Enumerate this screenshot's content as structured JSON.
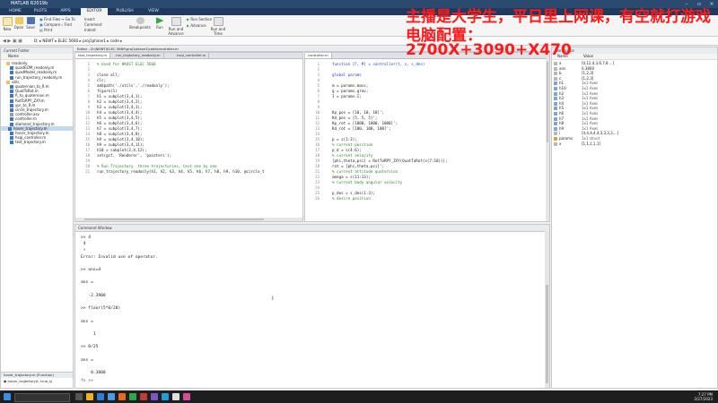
{
  "window": {
    "title": "MATLAB R2019b"
  },
  "tabs": [
    "HOME",
    "PLOTS",
    "APPS",
    "EDITOR",
    "PUBLISH",
    "VIEW"
  ],
  "ribbon": {
    "file": [
      "New",
      "Open",
      "Save"
    ],
    "navigate": [
      "Find Files",
      "Compare",
      "Print",
      "Go To",
      "Find"
    ],
    "edit": [
      "Insert",
      "Comment",
      "Indent"
    ],
    "breakpoints": "Breakpoints",
    "run": [
      "Run",
      "Run and Advance",
      "Run Section",
      "Advance",
      "Run and Time"
    ]
  },
  "address": {
    "path": "D: ▸ NEWT ▸ ELEC 5660 ▸ proj1phase1 ▸ code ▸"
  },
  "current_folder": {
    "title": "Current Folder",
    "column": "Name",
    "items": [
      {
        "name": "readonly",
        "type": "folder"
      },
      {
        "name": "quadEOM_readonly.m",
        "type": "m"
      },
      {
        "name": "quadModel_readonly.m",
        "type": "m"
      },
      {
        "name": "run_trajectory_readonly.m",
        "type": "m"
      },
      {
        "name": "utils",
        "type": "folder"
      },
      {
        "name": "quaternion_to_R.m",
        "type": "m"
      },
      {
        "name": "QuatToRot.m",
        "type": "m"
      },
      {
        "name": "R_to_quaternion.m",
        "type": "m"
      },
      {
        "name": "RotToRPY_ZXY.m",
        "type": "m"
      },
      {
        "name": "ypr_to_R.m",
        "type": "m"
      },
      {
        "name": "circle_trajectory.m",
        "type": "m"
      },
      {
        "name": "controller.asv",
        "type": "asv"
      },
      {
        "name": "controller.m",
        "type": "m"
      },
      {
        "name": "diamond_trajectory.m",
        "type": "m"
      },
      {
        "name": "hover_trajectory.m",
        "type": "m"
      },
      {
        "name": "hover_trajectory.m",
        "type": "m"
      },
      {
        "name": "hsqi_controller.m",
        "type": "m"
      },
      {
        "name": "test_trajectory.m",
        "type": "m"
      }
    ],
    "details_label": "hover_trajectory.m  (Function)",
    "details_item": "hover_trajectory(t, true_s)"
  },
  "editor_left": {
    "title": "Editor - D:\\NEWT\\ELEC 5660\\proj1phase1\\code\\controller.m",
    "tabs": [
      "test_trajectory.m",
      "run_trajectory_readonly.m",
      "hsqi_controller.m"
    ],
    "lines": [
      {
        "n": "1",
        "t": "% Used for HKUST ELEC 5660",
        "c": "cmt"
      },
      {
        "n": "2",
        "t": "",
        "c": ""
      },
      {
        "n": "3",
        "t": "close all;",
        "c": ""
      },
      {
        "n": "4",
        "t": "clc;",
        "c": ""
      },
      {
        "n": "5",
        "t": "addpath('./utils','./readonly');",
        "c": ""
      },
      {
        "n": "6",
        "t": "figure(1)",
        "c": ""
      },
      {
        "n": "7",
        "t": "h1 = subplot(3,4,1);",
        "c": ""
      },
      {
        "n": "8",
        "t": "h2 = subplot(3,4,2);",
        "c": ""
      },
      {
        "n": "9",
        "t": "h3 = subplot(3,4,3);",
        "c": ""
      },
      {
        "n": "10",
        "t": "h4 = subplot(3,4,4);",
        "c": ""
      },
      {
        "n": "11",
        "t": "h5 = subplot(3,4,5);",
        "c": ""
      },
      {
        "n": "12",
        "t": "h6 = subplot(3,4,6);",
        "c": ""
      },
      {
        "n": "13",
        "t": "h7 = subplot(3,4,7);",
        "c": ""
      },
      {
        "n": "14",
        "t": "h8 = subplot(3,4,8);",
        "c": ""
      },
      {
        "n": "15",
        "t": "h9 = subplot(3,4,10);",
        "c": ""
      },
      {
        "n": "16",
        "t": "h9 = subplot(3,4,11);",
        "c": ""
      },
      {
        "n": "17",
        "t": "h10 = subplot(3,4,12);",
        "c": ""
      },
      {
        "n": "18",
        "t": "set(gcf, 'Renderer', 'painters');",
        "c": ""
      },
      {
        "n": "19",
        "t": "",
        "c": ""
      },
      {
        "n": "20",
        "t": "% Run Trajectory  three trajectories, test one by one",
        "c": "cmt"
      },
      {
        "n": "21",
        "t": "run_trajectory_readonly(h1, h2, h3, h4, h5, h6, h7, h8, h9, h10, @circle_t",
        "c": ""
      }
    ]
  },
  "editor_right": {
    "tab": "controller.m",
    "lines": [
      {
        "n": "1",
        "t": "function [F, M] = controller(t, s, s_des)",
        "c": "kw"
      },
      {
        "n": "2",
        "t": "",
        "c": ""
      },
      {
        "n": "3",
        "t": "global params",
        "c": "kw"
      },
      {
        "n": "4",
        "t": "",
        "c": ""
      },
      {
        "n": "5",
        "t": "m = params.mass;",
        "c": ""
      },
      {
        "n": "6",
        "t": "g = params.grav;",
        "c": ""
      },
      {
        "n": "7",
        "t": "I = params.I;",
        "c": ""
      },
      {
        "n": "8",
        "t": "",
        "c": ""
      },
      {
        "n": "9",
        "t": "",
        "c": ""
      },
      {
        "n": "10",
        "t": "Kp_pos = [10, 10, 10]';",
        "c": ""
      },
      {
        "n": "11",
        "t": "Kd_pos = [5, 5, 5]';",
        "c": ""
      },
      {
        "n": "12",
        "t": "Kp_rot = [1000, 1000, 1000]';",
        "c": ""
      },
      {
        "n": "13",
        "t": "Kd_rot = [100, 100, 100]';",
        "c": ""
      },
      {
        "n": "14",
        "t": "",
        "c": ""
      },
      {
        "n": "15",
        "t": "p = s(1:3);",
        "c": ""
      },
      {
        "n": "16",
        "t": "% current position",
        "c": "cmt"
      },
      {
        "n": "17",
        "t": "p_d = s(4:6);",
        "c": ""
      },
      {
        "n": "18",
        "t": "% current velocity",
        "c": "cmt"
      },
      {
        "n": "19",
        "t": "[phi,theta,psi] = RotToRPY_ZXY(QuatToRot(s(7:10)));",
        "c": ""
      },
      {
        "n": "20",
        "t": "rot = [phi,theta,psi]';",
        "c": ""
      },
      {
        "n": "21",
        "t": "% current attitude quaternion",
        "c": "cmt"
      },
      {
        "n": "22",
        "t": "omega = s(11:13);",
        "c": ""
      },
      {
        "n": "23",
        "t": "% current body angular velocity",
        "c": "cmt"
      },
      {
        "n": "24",
        "t": "",
        "c": ""
      },
      {
        "n": "25",
        "t": "p_des = s_des(1:3);",
        "c": ""
      },
      {
        "n": "26",
        "t": "% desire position",
        "c": "cmt"
      }
    ]
  },
  "command_window": {
    "title": "Command Window",
    "lines": [
      {
        "t": ">> 4",
        "c": ""
      },
      {
        "t": " 4",
        "c": ""
      },
      {
        "t": " ↑",
        "c": "err"
      },
      {
        "t": "Error: Invalid use of operator.",
        "c": "err"
      },
      {
        "t": "",
        "c": ""
      },
      {
        "t": ">> ans=4",
        "c": ""
      },
      {
        "t": "",
        "c": ""
      },
      {
        "t": "ans =",
        "c": ""
      },
      {
        "t": "",
        "c": ""
      },
      {
        "t": "   -2.3900",
        "c": ""
      },
      {
        "t": "",
        "c": ""
      },
      {
        "t": ">> floor(5*0/20)",
        "c": ""
      },
      {
        "t": "",
        "c": ""
      },
      {
        "t": "ans =",
        "c": ""
      },
      {
        "t": "",
        "c": ""
      },
      {
        "t": "     1",
        "c": ""
      },
      {
        "t": "",
        "c": ""
      },
      {
        "t": ">> 0/25",
        "c": ""
      },
      {
        "t": "",
        "c": ""
      },
      {
        "t": "ans =",
        "c": ""
      },
      {
        "t": "",
        "c": ""
      },
      {
        "t": "    0.3800",
        "c": ""
      }
    ],
    "prompt": "fx >>"
  },
  "workspace": {
    "title": "Workspace",
    "columns": [
      "Name",
      "Value"
    ],
    "rows": [
      {
        "name": "a",
        "value": "[0,12,4,3,6,7,8 ...]"
      },
      {
        "name": "ans",
        "value": "0.3800"
      },
      {
        "name": "b",
        "value": "[1,2,3]"
      },
      {
        "name": "c",
        "value": "[1,2,3]"
      },
      {
        "name": "h1",
        "value": "1x1 Axes"
      },
      {
        "name": "h10",
        "value": "1x1 Axes"
      },
      {
        "name": "h2",
        "value": "1x1 Axes"
      },
      {
        "name": "h3",
        "value": "1x1 Axes"
      },
      {
        "name": "h4",
        "value": "1x1 Axes"
      },
      {
        "name": "h5",
        "value": "1x1 Axes"
      },
      {
        "name": "h6",
        "value": "1x1 Axes"
      },
      {
        "name": "h7",
        "value": "1x1 Axes"
      },
      {
        "name": "h8",
        "value": "1x1 Axes"
      },
      {
        "name": "h9",
        "value": "1x1 Axes"
      },
      {
        "name": "i",
        "value": "[4,4,4,4,4,3,3,3,3,...]"
      },
      {
        "name": "params",
        "value": "1x1 struct"
      },
      {
        "name": "x",
        "value": "[1,1,1,1,1]"
      }
    ]
  },
  "overlay": {
    "line1": "主播是大学生，平日里上网课，有空就打游戏",
    "line2": "电脑配置：",
    "line3": "2700X+3090+X470"
  },
  "taskbar": {
    "time": "7:27 PM",
    "date": "2/27/2023"
  },
  "colors": {
    "title_bar": "#2b4a6f",
    "tab_bar": "#1f3a5f",
    "overlay_text": "#ff1a1a",
    "selection": "#c4d8ef",
    "taskbar": "#1e1e1e"
  }
}
